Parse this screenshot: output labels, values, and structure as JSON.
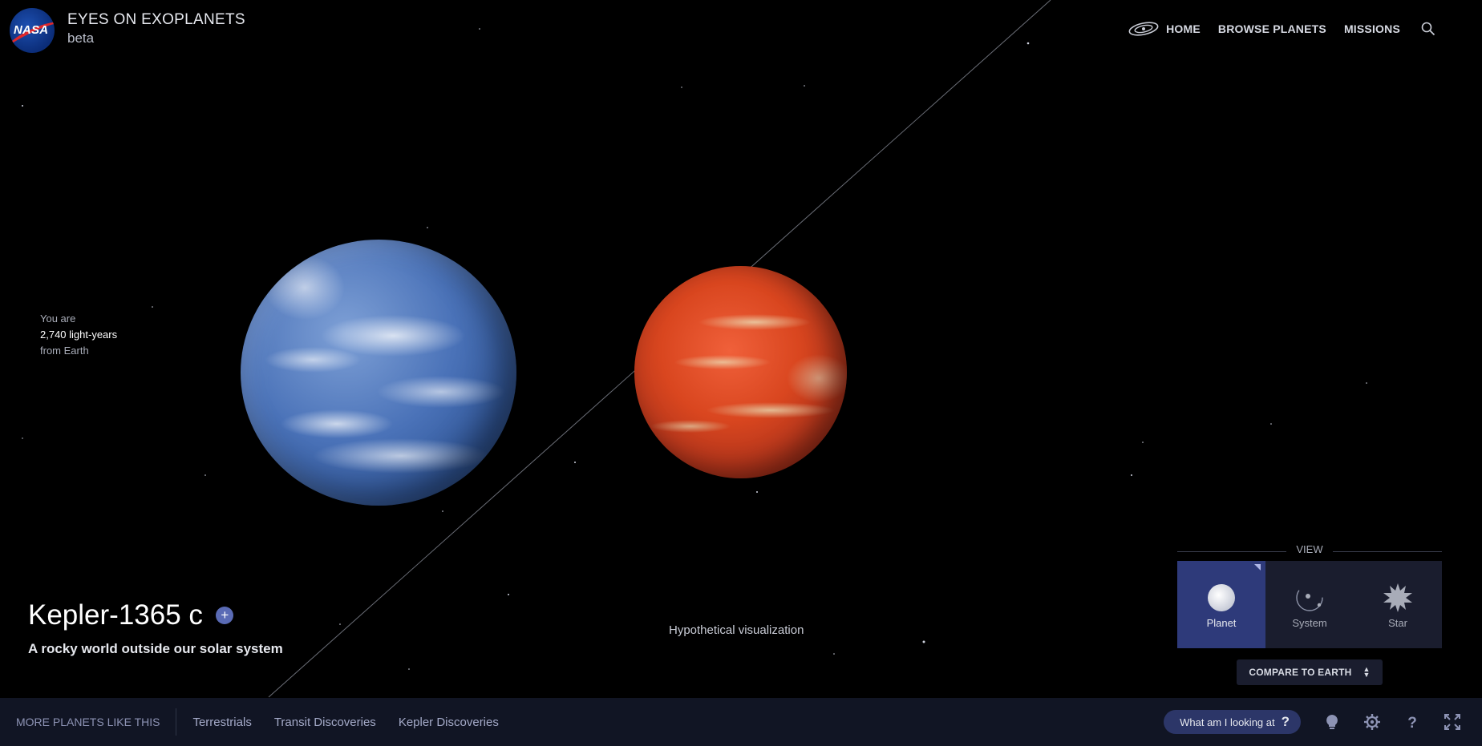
{
  "header": {
    "logo_text": "NASA",
    "title": "EYES ON EXOPLANETS",
    "subtitle": "beta"
  },
  "nav": {
    "items": [
      {
        "label": "HOME"
      },
      {
        "label": "BROWSE PLANETS"
      },
      {
        "label": "MISSIONS"
      }
    ],
    "search_icon": "search-icon",
    "home_icon": "galaxy-icon"
  },
  "distance": {
    "prefix": "You are",
    "value": "2,740 light-years",
    "suffix": "from Earth"
  },
  "planet": {
    "name": "Kepler-1365 c",
    "add_label": "+",
    "description": "A rocky world outside our solar system",
    "visualization_note": "Hypothetical visualization"
  },
  "view": {
    "heading": "VIEW",
    "options": [
      {
        "label": "Planet",
        "icon": "planet-icon",
        "active": true
      },
      {
        "label": "System",
        "icon": "system-icon",
        "active": false
      },
      {
        "label": "Star",
        "icon": "star-icon",
        "active": false
      }
    ],
    "compare_label": "COMPARE TO EARTH"
  },
  "footer": {
    "more_label": "MORE PLANETS LIKE THIS",
    "categories": [
      {
        "label": "Terrestrials"
      },
      {
        "label": "Transit Discoveries"
      },
      {
        "label": "Kepler Discoveries"
      }
    ],
    "looking_label": "What am I looking at",
    "looking_icon": "question-icon",
    "icons": [
      "lightbulb-icon",
      "gear-icon",
      "help-icon",
      "fullscreen-icon"
    ]
  },
  "colors": {
    "background": "#000000",
    "active_view": "#2e3a7a",
    "panel": "#1a1d2e",
    "footer": "#111524",
    "accent": "#5a6bb5"
  }
}
